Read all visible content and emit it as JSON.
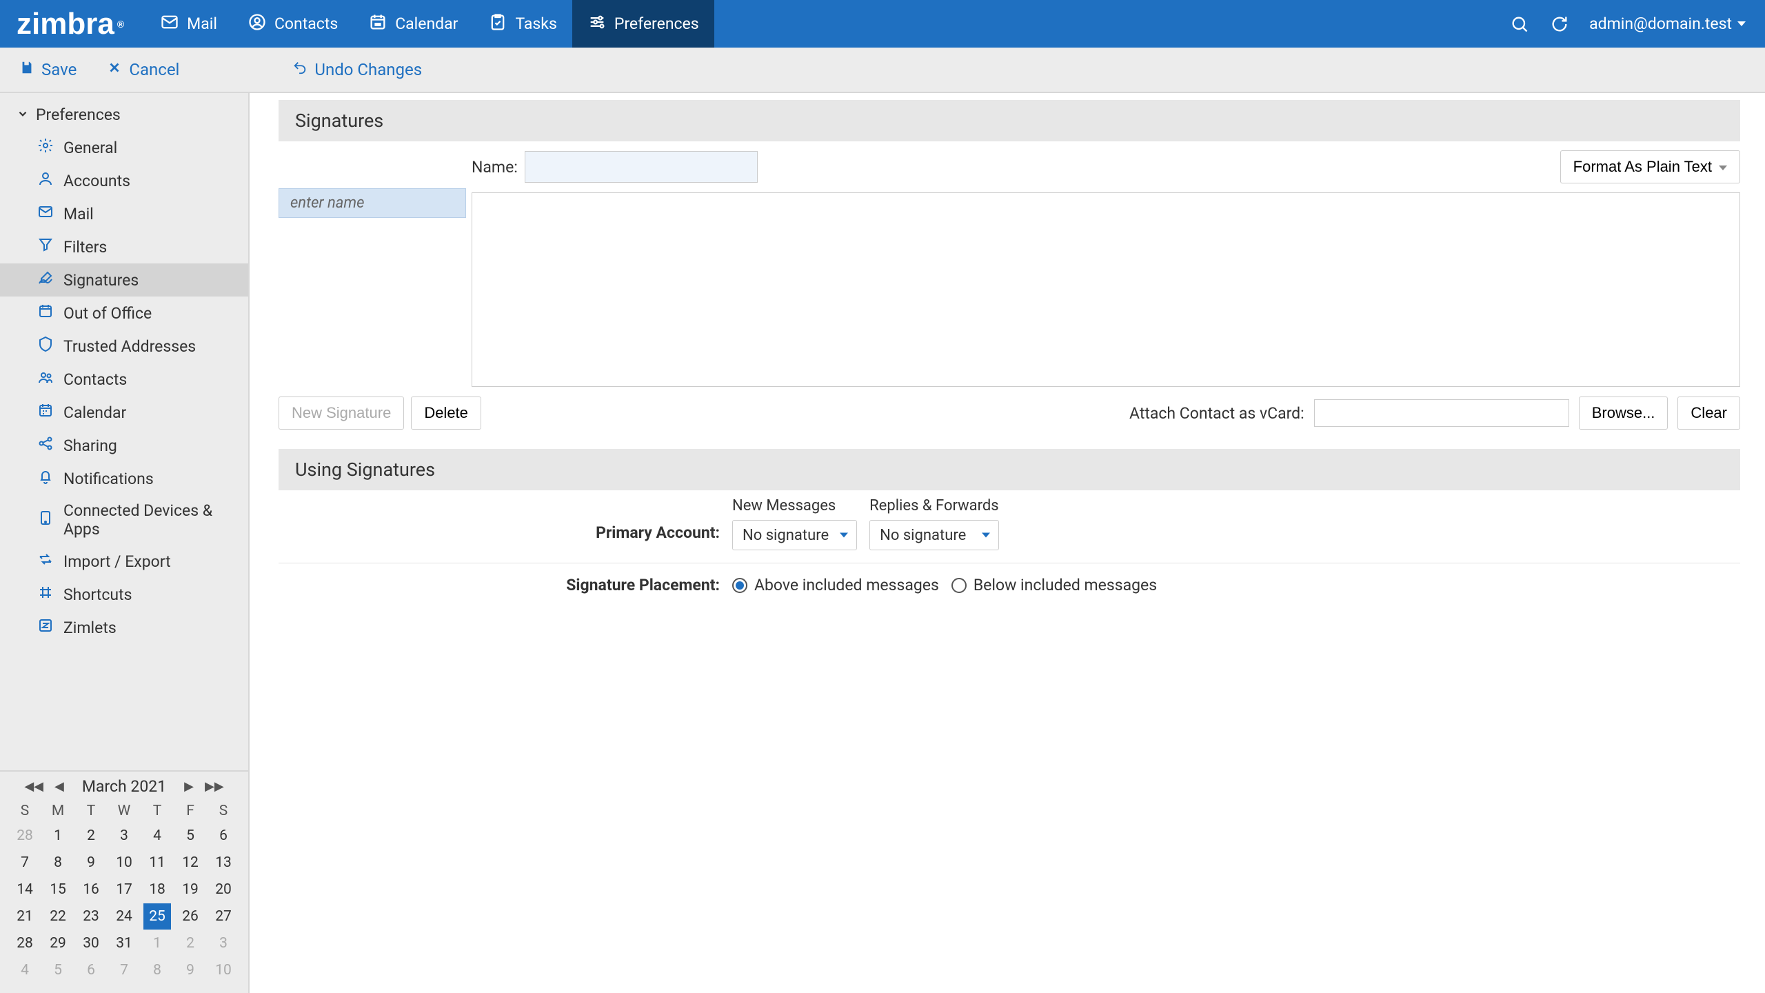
{
  "header": {
    "logo_text": "zimbra",
    "tabs": [
      {
        "id": "mail",
        "label": "Mail"
      },
      {
        "id": "contacts",
        "label": "Contacts"
      },
      {
        "id": "calendar",
        "label": "Calendar"
      },
      {
        "id": "tasks",
        "label": "Tasks"
      },
      {
        "id": "preferences",
        "label": "Preferences"
      }
    ],
    "user": "admin@domain.test"
  },
  "action_bar": {
    "save_label": "Save",
    "cancel_label": "Cancel",
    "undo_label": "Undo Changes"
  },
  "sidebar": {
    "root_label": "Preferences",
    "items": [
      {
        "id": "general",
        "label": "General"
      },
      {
        "id": "accounts",
        "label": "Accounts"
      },
      {
        "id": "mail",
        "label": "Mail"
      },
      {
        "id": "filters",
        "label": "Filters"
      },
      {
        "id": "signatures",
        "label": "Signatures",
        "selected": true
      },
      {
        "id": "out-of-office",
        "label": "Out of Office"
      },
      {
        "id": "trusted-addresses",
        "label": "Trusted Addresses"
      },
      {
        "id": "contacts",
        "label": "Contacts"
      },
      {
        "id": "calendar",
        "label": "Calendar"
      },
      {
        "id": "sharing",
        "label": "Sharing"
      },
      {
        "id": "notifications",
        "label": "Notifications"
      },
      {
        "id": "connected-devices",
        "label": "Connected Devices & Apps"
      },
      {
        "id": "import-export",
        "label": "Import / Export"
      },
      {
        "id": "shortcuts",
        "label": "Shortcuts"
      },
      {
        "id": "zimlets",
        "label": "Zimlets"
      }
    ]
  },
  "main": {
    "signatures_header": "Signatures",
    "name_label": "Name:",
    "name_value": "",
    "format_label": "Format As Plain Text",
    "sig_list_placeholder": "enter name",
    "sig_text_value": "",
    "new_sig_label": "New Signature",
    "delete_label": "Delete",
    "vcard_label": "Attach Contact as vCard:",
    "vcard_value": "",
    "browse_label": "Browse...",
    "clear_label": "Clear",
    "using_header": "Using Signatures",
    "new_messages_label": "New Messages",
    "replies_forwards_label": "Replies & Forwards",
    "primary_account_label": "Primary Account:",
    "no_signature_label": "No signature",
    "placement_label": "Signature Placement:",
    "above_label": "Above included messages",
    "below_label": "Below included messages"
  },
  "minical": {
    "title": "March 2021",
    "dow": [
      "S",
      "M",
      "T",
      "W",
      "T",
      "F",
      "S"
    ],
    "weeks": [
      [
        {
          "d": 28,
          "o": true
        },
        {
          "d": 1
        },
        {
          "d": 2
        },
        {
          "d": 3
        },
        {
          "d": 4
        },
        {
          "d": 5
        },
        {
          "d": 6
        }
      ],
      [
        {
          "d": 7
        },
        {
          "d": 8
        },
        {
          "d": 9
        },
        {
          "d": 10
        },
        {
          "d": 11
        },
        {
          "d": 12
        },
        {
          "d": 13
        }
      ],
      [
        {
          "d": 14
        },
        {
          "d": 15
        },
        {
          "d": 16
        },
        {
          "d": 17
        },
        {
          "d": 18
        },
        {
          "d": 19
        },
        {
          "d": 20
        }
      ],
      [
        {
          "d": 21
        },
        {
          "d": 22
        },
        {
          "d": 23
        },
        {
          "d": 24
        },
        {
          "d": 25,
          "t": true
        },
        {
          "d": 26
        },
        {
          "d": 27
        }
      ],
      [
        {
          "d": 28
        },
        {
          "d": 29
        },
        {
          "d": 30
        },
        {
          "d": 31
        },
        {
          "d": 1,
          "o": true
        },
        {
          "d": 2,
          "o": true
        },
        {
          "d": 3,
          "o": true
        }
      ],
      [
        {
          "d": 4,
          "o": true
        },
        {
          "d": 5,
          "o": true
        },
        {
          "d": 6,
          "o": true
        },
        {
          "d": 7,
          "o": true
        },
        {
          "d": 8,
          "o": true
        },
        {
          "d": 9,
          "o": true
        },
        {
          "d": 10,
          "o": true
        }
      ]
    ]
  }
}
